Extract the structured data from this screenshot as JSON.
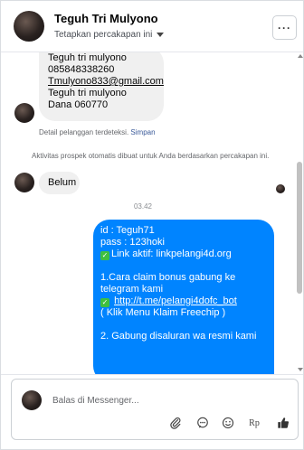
{
  "header": {
    "name": "Teguh Tri Mulyono",
    "subtitle": "Tetapkan percakapan ini",
    "more_label": "···"
  },
  "messages": {
    "contact_lines": [
      "Teguh tri mulyono",
      "085848338260",
      "Tmulyono833@gmail.com",
      "Teguh tri mulyono",
      "Dana 060770"
    ],
    "detected_note": "Detail pelanggan terdeteksi.",
    "detected_link": "Simpan",
    "auto_note": "Aktivitas prospek otomatis dibuat untuk Anda berdasarkan percakapan ini.",
    "reply": "Belum",
    "time": "03.42",
    "outgoing": {
      "l1": "id : Teguh71",
      "l2": "pass : 123hoki",
      "l3": "Link aktif: linkpelangi4d.org",
      "l4": "1.Cara claim bonus gabung ke telegram kami",
      "l5": "http://t.me/pelangi4dofc_bot",
      "l6": "( Klik Menu Klaim Freechip )",
      "l7": "2. Gabung disaluran wa resmi kami"
    }
  },
  "composer": {
    "placeholder": "Balas di Messenger...",
    "tools": [
      "paperclip-icon",
      "messenger-icon",
      "emoji-icon",
      "Rp",
      "thumbs-up-icon"
    ],
    "rp_label": "Rp"
  },
  "colors": {
    "accent": "#0084ff",
    "bubble_in": "#f0f0f0",
    "check": "#3fbf3f"
  }
}
